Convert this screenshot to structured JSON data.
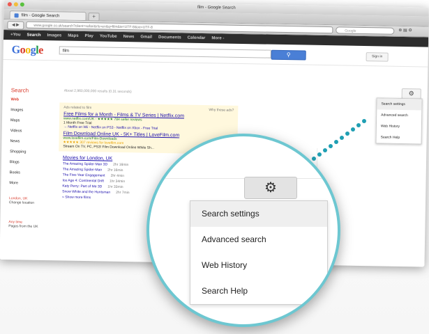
{
  "window": {
    "title": "film - Google Search",
    "tab_label": "film - Google Search",
    "new_tab": "+",
    "url": "www.google.co.uk/search?client=safari&rls=en&q=film&ie=UTF-8&oe=UTF-8",
    "search_placeholder": "Google"
  },
  "gbar": {
    "items": [
      "+You",
      "Search",
      "Images",
      "Maps",
      "Play",
      "YouTube",
      "News",
      "Gmail",
      "Documents",
      "Calendar",
      "More -"
    ]
  },
  "search": {
    "logo": [
      "G",
      "o",
      "o",
      "g",
      "l",
      "e"
    ],
    "query": "film",
    "button_icon": "search-icon",
    "signin": "Sign in",
    "label": "Search",
    "stats": "About 2,960,000,000 results (0.31 seconds)"
  },
  "leftnav": {
    "items": [
      "Web",
      "Images",
      "Maps",
      "Videos",
      "News",
      "Shopping",
      "Blogs",
      "Books",
      "More"
    ],
    "location_title": "London, UK",
    "location_change": "Change location",
    "time_title": "Any time",
    "time_item": "Pages from the UK"
  },
  "ads": {
    "header": "Ads related to film",
    "why": "Why these ads?",
    "items": [
      {
        "title": "Free Films for a Month - Films & TV Series | Netflix.com",
        "url": "www.netflix.com/UK - ★★★★★ 784 seller reviews",
        "lines": [
          "1 Month Free Trial",
          "→ Netflix on Wii - Netflix on PS3 - Netflix on Xbox - Free Trial"
        ]
      },
      {
        "title": "Film Download Online UK - 5K+ Titles | LoveFilm.com",
        "url": "www.lovefilm.com/Film-Downloads",
        "lines": [
          "★★★★★ 307 reviews for lovefilm.com",
          "Stream On TV, PC, PS3! Film Download Online While Sh..."
        ]
      }
    ]
  },
  "organic": {
    "title": "Movies for London, UK",
    "rows": [
      {
        "name": "The Amazing Spider-Man 3D",
        "meta": "2hr 16min"
      },
      {
        "name": "The Amazing Spider-Man",
        "meta": "2hr 16min"
      },
      {
        "name": "The Five-Year Engagement",
        "meta": "2hr 4min"
      },
      {
        "name": "Ice Age 4: Continental Drift",
        "meta": "1hr 34min"
      },
      {
        "name": "Katy Perry: Part of Me 3D",
        "meta": "1hr 33min"
      },
      {
        "name": "Snow White and the Huntsman",
        "meta": "2hr 7min"
      },
      {
        "name": "» Show more films",
        "meta": ""
      }
    ]
  },
  "settings_menu": {
    "gear_icon": "gear-icon",
    "items": [
      "Search settings",
      "Advanced search",
      "Web History",
      "Search Help"
    ],
    "selected": "Search settings"
  },
  "colors": {
    "accent": "#6dc7d1",
    "google_blue": "#4a7fd6",
    "red": "#d93a2b",
    "link": "#1a0dab",
    "url_green": "#1a7a2a"
  }
}
